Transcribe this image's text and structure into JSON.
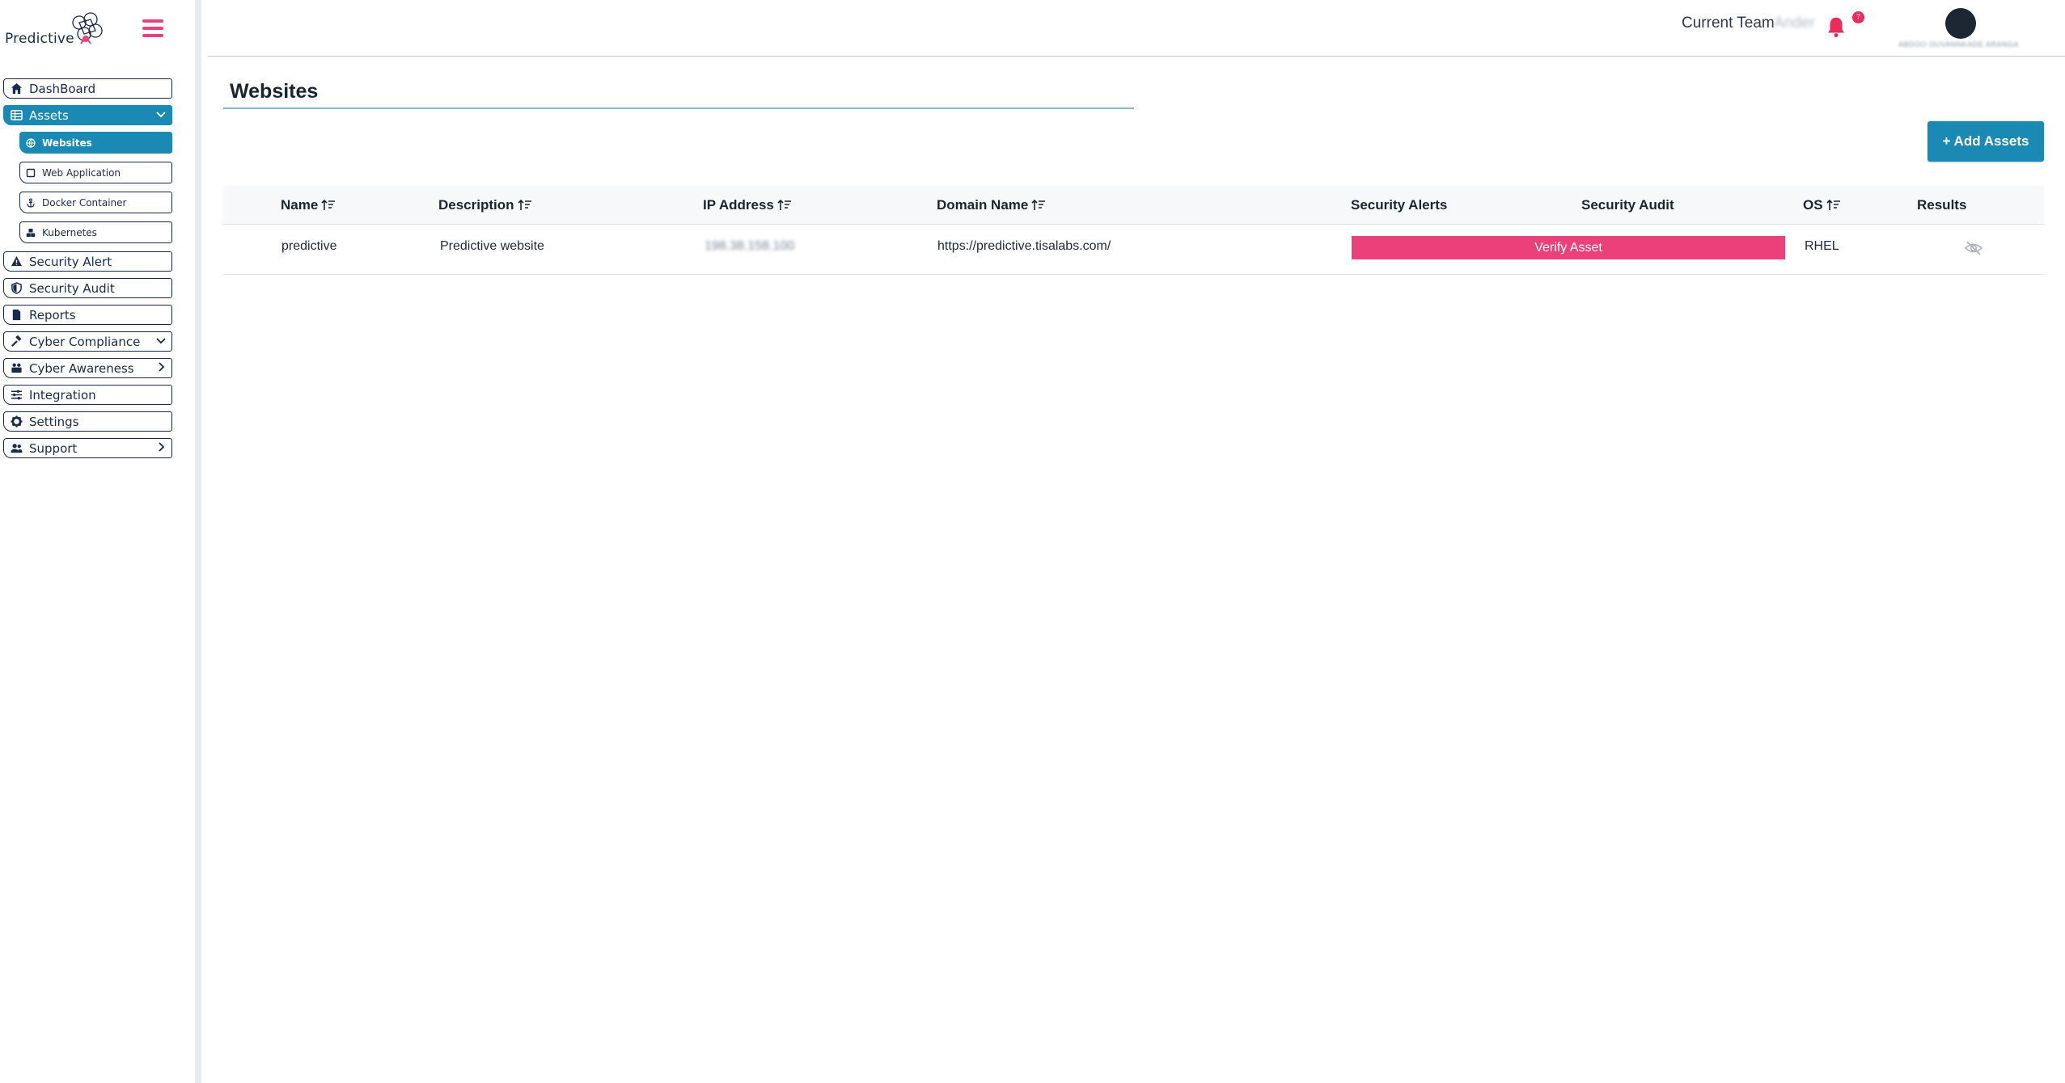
{
  "brand": {
    "name": "Predictive"
  },
  "sidebar": {
    "items": [
      {
        "label": "DashBoard",
        "icon": "home-icon"
      },
      {
        "label": "Assets",
        "icon": "table-icon",
        "active": true,
        "chevron": "down"
      },
      {
        "label": "Security Alert",
        "icon": "warning-icon"
      },
      {
        "label": "Security Audit",
        "icon": "shield-icon"
      },
      {
        "label": "Reports",
        "icon": "file-icon"
      },
      {
        "label": "Cyber Compliance",
        "icon": "gavel-icon",
        "chevron": "down"
      },
      {
        "label": "Cyber Awareness",
        "icon": "people-icon",
        "chevron": "right"
      },
      {
        "label": "Integration",
        "icon": "sliders-icon"
      },
      {
        "label": "Settings",
        "icon": "gear-icon"
      },
      {
        "label": "Support",
        "icon": "users-icon",
        "chevron": "right"
      }
    ],
    "assets_sub": [
      {
        "label": "Websites",
        "icon": "globe-icon",
        "active": true
      },
      {
        "label": "Web Application",
        "icon": "window-icon"
      },
      {
        "label": "Docker Container",
        "icon": "anchor-icon"
      },
      {
        "label": "Kubernetes",
        "icon": "cubes-icon"
      }
    ]
  },
  "header": {
    "team_label": "Current Team",
    "team_name": "Ander",
    "notification_count": "7",
    "user_name": "ABDOO OUVANNKADE ARANGA"
  },
  "main": {
    "title": "Websites",
    "add_button": "+ Add Assets",
    "columns": {
      "name": "Name",
      "description": "Description",
      "ip": "IP Address",
      "domain": "Domain Name",
      "alerts": "Security Alerts",
      "audit": "Security Audit",
      "os": "OS",
      "results": "Results"
    },
    "rows": [
      {
        "name": "predictive",
        "description": "Predictive website",
        "ip": "198.38.158.100",
        "domain": "https://predictive.tisalabs.com/",
        "action": "Verify Asset",
        "os": "RHEL"
      }
    ]
  },
  "colors": {
    "accent": "#1a8ab5",
    "pink": "#ec407a",
    "navy": "#1b2a4a"
  }
}
